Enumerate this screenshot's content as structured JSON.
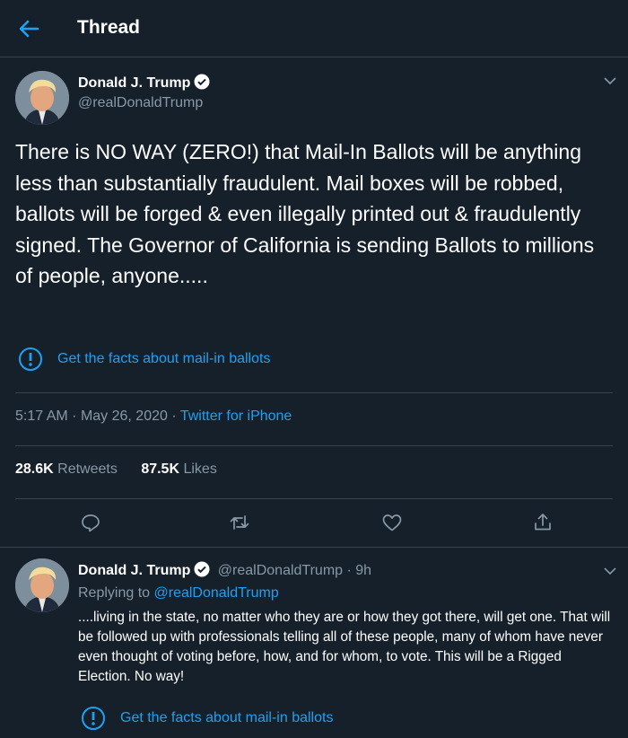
{
  "header": {
    "title": "Thread"
  },
  "tweet": {
    "author_name": "Donald J. Trump",
    "author_handle": "@realDonaldTrump",
    "text": "There is NO WAY (ZERO!) that Mail-In Ballots will be anything less than substantially fraudulent. Mail boxes will be robbed, ballots will be forged & even illegally printed out & fraudulently signed. The Governor of California is sending Ballots to millions of people, anyone.....",
    "facts_label": "Get the facts about mail-in ballots",
    "time": "5:17 AM",
    "date": "May 26, 2020",
    "source": "Twitter for iPhone",
    "retweets_count": "28.6K",
    "retweets_label": "Retweets",
    "likes_count": "87.5K",
    "likes_label": "Likes"
  },
  "reply": {
    "author_name": "Donald J. Trump",
    "author_handle": "@realDonaldTrump",
    "age": "9h",
    "replying_label": "Replying to",
    "replying_to": "@realDonaldTrump",
    "text": "....living in the state, no matter who they are or how they got there, will get one. That will be followed up with professionals telling all of these people, many of whom have never even thought of voting before, how, and for whom, to vote. This will be a Rigged Election. No way!",
    "facts_label": "Get the facts about mail-in ballots"
  },
  "colors": {
    "background": "#15202b",
    "accent": "#1da1f2",
    "secondary_text": "#8899a6",
    "border": "#38444d"
  },
  "icons": [
    "back-arrow-icon",
    "verified-icon",
    "chevron-down-icon",
    "info-icon",
    "reply-icon",
    "retweet-icon",
    "like-icon",
    "share-icon"
  ]
}
